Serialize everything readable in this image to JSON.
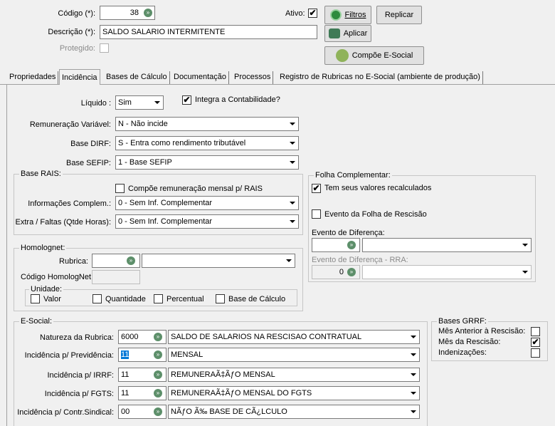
{
  "header": {
    "codigo_label": "Código (*):",
    "codigo_value": "38",
    "descricao_label": "Descrição (*):",
    "descricao_value": "SALDO SALARIO INTERMITENTE",
    "protegido_label": "Protegido:",
    "ativo_label": "Ativo:",
    "ativo_checked": "✔",
    "btn_filtros": "Filtros",
    "btn_replicar": "Replicar",
    "btn_aplicar": "Aplicar",
    "btn_compoe": "Compõe E-Social"
  },
  "tabs": [
    "Propriedades",
    "Incidência",
    "Bases de Cálculo",
    "Documentação",
    "Processos",
    "Registro de Rubricas no E-Social (ambiente de produção)"
  ],
  "incidencia": {
    "liquido_label": "Líquido :",
    "liquido_value": "Sim",
    "integra_label": "Integra a Contabilidade?",
    "integra_checked": "✔",
    "remuneracao_label": "Remuneração Variável:",
    "remuneracao_value": "N - Não incide",
    "dirf_label": "Base DIRF:",
    "dirf_value": "S - Entra como rendimento tributável",
    "sefip_label": "Base SEFIP:",
    "sefip_value": "1 - Base SEFIP"
  },
  "rais": {
    "title": "Base RAIS:",
    "compoe_label": "Compõe remuneração mensal p/ RAIS",
    "info_label": "Informações Complem.:",
    "info_value": "0 - Sem Inf. Complementar",
    "extra_label": "Extra / Faltas (Qtde Horas):",
    "extra_value": "0 - Sem Inf. Complementar"
  },
  "folha": {
    "title": "Folha Complementar:",
    "recalc_label": "Tem seus valores recalculados",
    "recalc_checked": "✔",
    "rescisao_label": "Evento da Folha de Rescisão",
    "diferenca_label": "Evento de Diferença:",
    "rra_label": "Evento de Diferença - RRA:",
    "rra_value": "0"
  },
  "homolognet": {
    "title": "Homolognet:",
    "rubrica_label": "Rubrica:",
    "codigo_label": "Código HomologNet",
    "unidade_title": "Unidade:",
    "valor": "Valor",
    "quantidade": "Quantidade",
    "percentual": "Percentual",
    "base_calculo": "Base de Cálculo"
  },
  "esocial": {
    "title": "E-Social:",
    "natureza_label": "Natureza da Rubrica:",
    "natureza_code": "6000",
    "natureza_value": "SALDO DE SALARIOS NA RESCISAO CONTRATUAL",
    "prev_label": "Incidência p/ Previdência:",
    "prev_code": "11",
    "prev_value": "MENSAL",
    "irrf_label": "Incidência p/ IRRF:",
    "irrf_code": "11",
    "irrf_value": "REMUNERAÃ‡ÃƒO MENSAL",
    "fgts_label": "Incidência p/ FGTS:",
    "fgts_code": "11",
    "fgts_value": "REMUNERAÃ‡ÃƒO MENSAL DO FGTS",
    "sind_label": "Incidência p/ Contr.Sindical:",
    "sind_code": "00",
    "sind_value": "NÃƒO Ã‰ BASE DE CÃ¿LCULO"
  },
  "grrf": {
    "title": "Bases GRRF:",
    "anterior_label": "Mês Anterior à Rescisão:",
    "mes_label": "Mês da Rescisão:",
    "mes_checked": "✔",
    "indenizacoes_label": "Indenizações:"
  },
  "icons": {
    "lookup": "arrow-circle-icon",
    "filtros": "green-circle-icon",
    "aplicar": "apply-icon",
    "compoe": "esocial-icon"
  }
}
